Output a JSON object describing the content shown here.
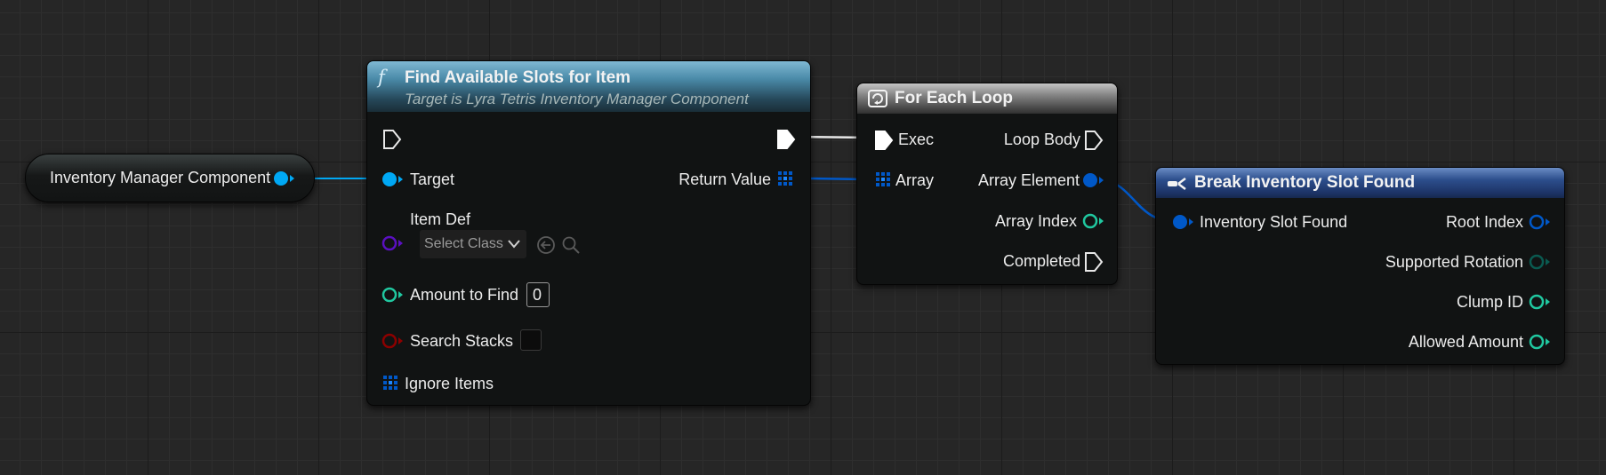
{
  "ref_node": {
    "label": "Inventory Manager Component"
  },
  "find_node": {
    "function_icon": "f",
    "title": "Find Available Slots for Item",
    "subtitle": "Target is Lyra Tetris Inventory Manager Component",
    "target_label": "Target",
    "return_label": "Return Value",
    "item_def_label": "Item Def",
    "select_class": "Select Class",
    "amount_label": "Amount to Find",
    "amount_value": "0",
    "search_stacks_label": "Search Stacks",
    "ignore_items_label": "Ignore Items"
  },
  "loop_node": {
    "title": "For Each Loop",
    "exec_label": "Exec",
    "loop_body_label": "Loop Body",
    "array_label": "Array",
    "array_element_label": "Array Element",
    "array_index_label": "Array Index",
    "completed_label": "Completed"
  },
  "break_node": {
    "title": "Break Inventory Slot Found",
    "input_label": "Inventory Slot Found",
    "root_index_label": "Root Index",
    "supported_rotation_label": "Supported Rotation",
    "clump_id_label": "Clump ID",
    "allowed_amount_label": "Allowed Amount"
  },
  "colors": {
    "object_pin": "#00a8f4",
    "struct_pin": "#0058c8",
    "int_pin": "#20c8a0",
    "class_pin": "#5a10c0",
    "bool_pin": "#8c0000",
    "exec_pin": "#ffffff",
    "function_header": "#4a8aa8",
    "loop_header": "#808080",
    "break_header": "#2c4e8c"
  },
  "icons": {
    "function": "function-icon",
    "loop": "loop-macro-icon",
    "break": "break-struct-icon",
    "array": "array-grid-icon",
    "back": "back-arrow-icon",
    "browse": "magnifier-icon",
    "dropdown": "chevron-down-icon"
  }
}
